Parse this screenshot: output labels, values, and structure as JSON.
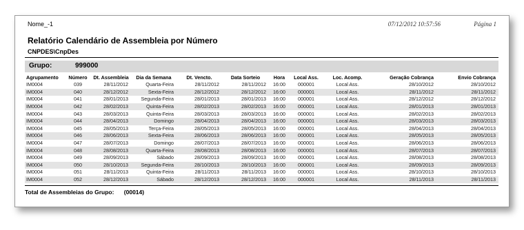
{
  "report": {
    "doc_name": "Nome_-1",
    "timestamp": "07/12/2012 10:57:56",
    "page_label": "Página 1",
    "title": "Relatório Calendário de Assembleia por Número",
    "subtitle": "CNPDES\\CnpDes",
    "group_label": "Grupo:",
    "group_value": "999000",
    "total_label": "Total de Assembleias do Grupo:",
    "total_value": "(00014)"
  },
  "columns": [
    "Agrupamento",
    "Número",
    "Dt. Assembleia",
    "Dia da Semana",
    "Dt. Vencto.",
    "Data Sorteio",
    "Hora",
    "Local Ass.",
    "Loc. Acomp.",
    "Geração Cobrança",
    "Envio Cobrança"
  ],
  "rows": [
    [
      "IM0004",
      "039",
      "28/11/2012",
      "Quarta-Feira",
      "28/11/2012",
      "28/11/2012",
      "16:00",
      "000001",
      "Local Ass.",
      "28/10/2012",
      "28/10/2012"
    ],
    [
      "IM0004",
      "040",
      "28/12/2012",
      "Sexta-Feira",
      "28/12/2012",
      "28/12/2012",
      "16:00",
      "000001",
      "Local Ass.",
      "28/11/2012",
      "28/11/2012"
    ],
    [
      "IM0004",
      "041",
      "28/01/2013",
      "Segunda-Feira",
      "28/01/2013",
      "28/01/2013",
      "16:00",
      "000001",
      "Local Ass.",
      "28/12/2012",
      "28/12/2012"
    ],
    [
      "IM0004",
      "042",
      "28/02/2013",
      "Quinta-Feira",
      "28/02/2013",
      "28/02/2013",
      "16:00",
      "000001",
      "Local Ass.",
      "28/01/2013",
      "28/01/2013"
    ],
    [
      "IM0004",
      "043",
      "28/03/2013",
      "Quinta-Feira",
      "28/03/2013",
      "28/03/2013",
      "16:00",
      "000001",
      "Local Ass.",
      "28/02/2013",
      "28/02/2013"
    ],
    [
      "IM0004",
      "044",
      "28/04/2013",
      "Domingo",
      "28/04/2013",
      "28/04/2013",
      "16:00",
      "000001",
      "Local Ass.",
      "28/03/2013",
      "28/03/2013"
    ],
    [
      "IM0004",
      "045",
      "28/05/2013",
      "Terça-Feira",
      "28/05/2013",
      "28/05/2013",
      "16:00",
      "000001",
      "Local Ass.",
      "28/04/2013",
      "28/04/2013"
    ],
    [
      "IM0004",
      "046",
      "28/06/2013",
      "Sexta-Feira",
      "28/06/2013",
      "28/06/2013",
      "16:00",
      "000001",
      "Local Ass.",
      "28/05/2013",
      "28/05/2013"
    ],
    [
      "IM0004",
      "047",
      "28/07/2013",
      "Domingo",
      "28/07/2013",
      "28/07/2013",
      "16:00",
      "000001",
      "Local Ass.",
      "28/06/2013",
      "28/06/2013"
    ],
    [
      "IM0004",
      "048",
      "28/08/2013",
      "Quarta-Feira",
      "28/08/2013",
      "28/08/2013",
      "16:00",
      "000001",
      "Local Ass.",
      "28/07/2013",
      "28/07/2013"
    ],
    [
      "IM0004",
      "049",
      "28/09/2013",
      "Sábado",
      "28/09/2013",
      "28/09/2013",
      "16:00",
      "000001",
      "Local Ass.",
      "28/08/2013",
      "28/08/2013"
    ],
    [
      "IM0004",
      "050",
      "28/10/2013",
      "Segunda-Feira",
      "28/10/2013",
      "28/10/2013",
      "16:00",
      "000001",
      "Local Ass.",
      "28/09/2013",
      "28/09/2013"
    ],
    [
      "IM0004",
      "051",
      "28/11/2013",
      "Quinta-Feira",
      "28/11/2013",
      "28/11/2013",
      "16:00",
      "000001",
      "Local Ass.",
      "28/10/2013",
      "28/10/2013"
    ],
    [
      "IM0004",
      "052",
      "28/12/2013",
      "Sábado",
      "28/12/2013",
      "28/12/2013",
      "16:00",
      "000001",
      "Local Ass.",
      "28/11/2013",
      "28/11/2013"
    ]
  ]
}
